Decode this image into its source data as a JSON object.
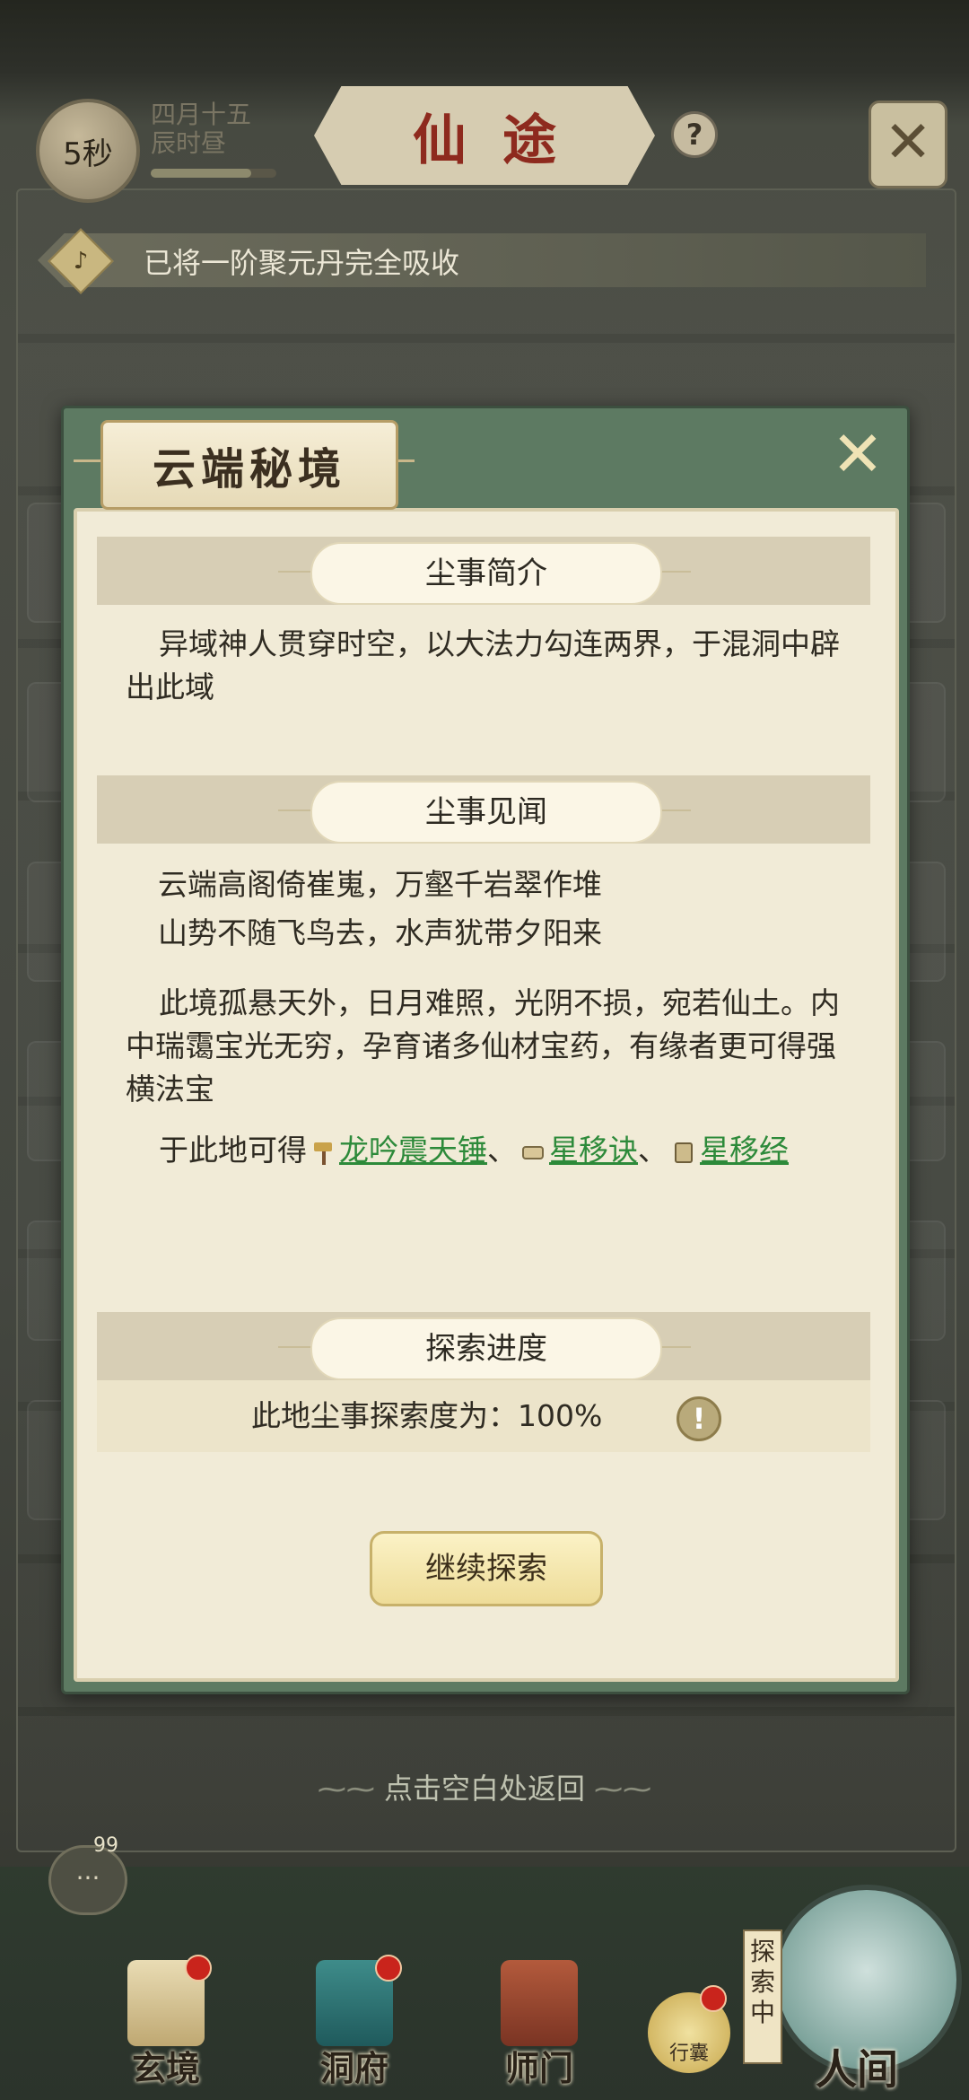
{
  "topbar": {
    "timer": "5秒",
    "date_line1": "四月十五",
    "date_line2": "辰时昼",
    "title": "仙途",
    "help_icon": "question-icon",
    "close_icon": "close-icon"
  },
  "notice": {
    "icon": "bell-icon",
    "text": "已将一阶聚元丹完全吸收"
  },
  "dialog": {
    "title": "云端秘境",
    "close_icon": "close-icon",
    "section_intro": {
      "heading": "尘事简介",
      "text": "异域神人贯穿时空，以大法力勾连两界，于混洞中辟出此域"
    },
    "section_story": {
      "heading": "尘事见闻",
      "poem_line1": "云端高阁倚崔嵬，万壑千岩翠作堆",
      "poem_line2": "山势不随飞鸟去，水声犹带夕阳来",
      "paragraph": "此境孤悬天外，日月难照，光阴不损，宛若仙土。内中瑞霭宝光无穷，孕育诸多仙材宝药，有缘者更可得强横法宝",
      "rewards_prefix": "于此地可得",
      "rewards": [
        {
          "name": "龙吟震天锤",
          "icon": "hammer-icon"
        },
        {
          "name": "星移诀",
          "icon": "scroll-icon"
        },
        {
          "name": "星移经",
          "icon": "book-icon"
        }
      ],
      "separator": "、"
    },
    "section_progress": {
      "heading": "探索进度",
      "label": "此地尘事探索度为：",
      "value": "100%",
      "info_icon": "exclamation-icon"
    },
    "continue_button": "继续探索"
  },
  "hint": "点击空白处返回",
  "chat": {
    "badge": "99"
  },
  "bottom_nav": [
    {
      "label": "玄境"
    },
    {
      "label": "洞府"
    },
    {
      "label": "师门"
    },
    {
      "label": "行囊"
    },
    {
      "label": "人间"
    }
  ],
  "explore_tag": "探索中",
  "colors": {
    "link": "#2d8a3a",
    "title_red": "#8e2a1e",
    "dialog_green": "#5d7a62"
  }
}
